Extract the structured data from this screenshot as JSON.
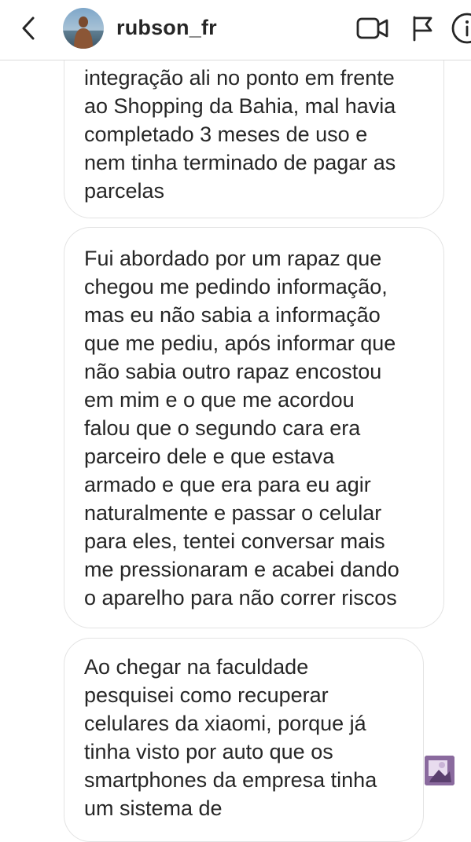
{
  "header": {
    "username": "rubson_fr"
  },
  "messages": [
    {
      "lines": [
        "integração ali no ponto em frente",
        "ao Shopping da Bahia, mal havia",
        "completado 3 meses de uso e",
        "nem tinha terminado de pagar as",
        "parcelas"
      ]
    },
    {
      "lines": [
        "Fui abordado por um rapaz que",
        "chegou me pedindo informação,",
        "mas eu não sabia a informação",
        "que me pediu, após informar que",
        "não sabia outro rapaz encostou",
        "em mim e o que me acordou",
        "falou que o segundo cara era",
        "parceiro dele e que estava",
        "armado e que era para eu agir",
        "naturalmente e passar o celular",
        "para eles, tentei conversar mais",
        "me pressionaram e acabei dando",
        "o aparelho para não correr riscos"
      ]
    },
    {
      "lines": [
        "Ao chegar na faculdade",
        "pesquisei como recuperar",
        "celulares da xiaomi, porque já",
        "tinha visto por auto que os",
        "smartphones da empresa tinha",
        "um sistema de"
      ]
    }
  ],
  "icons": {
    "back": "chevron-left-icon",
    "video": "video-camera-icon",
    "flag": "flag-icon",
    "info": "info-icon"
  }
}
